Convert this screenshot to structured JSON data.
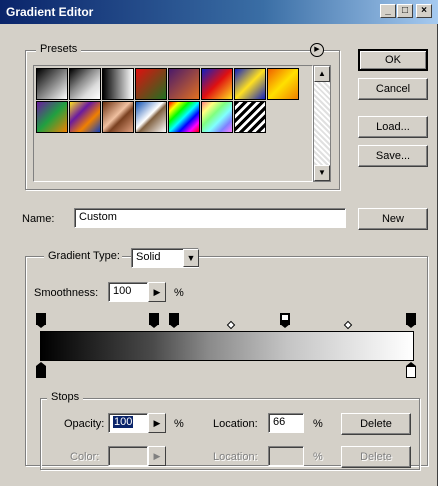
{
  "window": {
    "title": "Gradient Editor",
    "controls": [
      "_",
      "□",
      "×"
    ]
  },
  "buttons": {
    "ok": "OK",
    "cancel": "Cancel",
    "load": "Load...",
    "save": "Save...",
    "new": "New"
  },
  "presets": {
    "label": "Presets",
    "menu_icon": "circle-arrow-icon",
    "swatches": [
      {
        "name": "foreground-to-background",
        "fill": "linear-gradient(135deg,#000 0%,#fff 100%)"
      },
      {
        "name": "foreground-to-transparent",
        "fill": "linear-gradient(135deg,#000 0%,#888 40%,#ddd 70%,#fff 100%)"
      },
      {
        "name": "black-white",
        "fill": "linear-gradient(90deg,#000 0%,#fff 100%)"
      },
      {
        "name": "red-green",
        "fill": "linear-gradient(135deg,#e01010 0%,#207020 100%)"
      },
      {
        "name": "violet-orange",
        "fill": "linear-gradient(135deg,#4a1a6a 0%,#e07020 100%)"
      },
      {
        "name": "blue-red-yellow",
        "fill": "linear-gradient(135deg,#1020c0 0%,#e01010 50%,#ffe020 100%)"
      },
      {
        "name": "blue-yellow-blue",
        "fill": "linear-gradient(135deg,#1020c0 0%,#ffe020 50%,#1020c0 100%)"
      },
      {
        "name": "orange-yellow-orange",
        "fill": "linear-gradient(135deg,#f06000 0%,#ffe000 50%,#f08000 100%)"
      },
      {
        "name": "violet-green-orange",
        "fill": "linear-gradient(135deg,#6a1aa0 0%,#20a040 50%,#f08000 100%)"
      },
      {
        "name": "yellow-violet-orange-blue",
        "fill": "linear-gradient(135deg,#ffe020 0%,#6a1aa0 35%,#f08000 65%,#1040c0 100%)"
      },
      {
        "name": "copper",
        "fill": "linear-gradient(135deg,#6a3010 0%,#f0c0a0 45%,#7a4020 60%,#e0a080 100%)"
      },
      {
        "name": "chrome",
        "fill": "linear-gradient(135deg,#1050b0 0%,#ffffff 45%,#806040 55%,#ffffff 100%)"
      },
      {
        "name": "spectrum",
        "fill": "linear-gradient(135deg,#ff0000,#ffff00,#00ff00,#00ffff,#0000ff,#ff00ff,#ff0000)"
      },
      {
        "name": "transparent-rainbow",
        "fill": "linear-gradient(135deg,#ff8080,#ffff80,#80ff80,#80ffff,#8080ff,#ff80ff)"
      },
      {
        "name": "transparent-stripes",
        "fill": "repeating-linear-gradient(135deg,#000 0 3px,#fff 3px 6px)"
      }
    ]
  },
  "name_field": {
    "label": "Name:",
    "value": "Custom"
  },
  "gradient_type": {
    "label": "Gradient Type:",
    "value": "Solid"
  },
  "smoothness": {
    "label": "Smoothness:",
    "value": "100",
    "unit": "%"
  },
  "stops_section": {
    "label": "Stops",
    "opacity_label": "Opacity:",
    "opacity_value": "100",
    "opacity_unit": "%",
    "location_label": "Location:",
    "location_value": "66",
    "location_unit": "%",
    "delete_label": "Delete",
    "color_label": "Color:",
    "color_location_label": "Location:",
    "color_location_unit": "%",
    "color_delete_label": "Delete"
  },
  "colors": {
    "title_start": "#0a246a",
    "title_end": "#a6caf0",
    "face": "#d4d0c8"
  }
}
